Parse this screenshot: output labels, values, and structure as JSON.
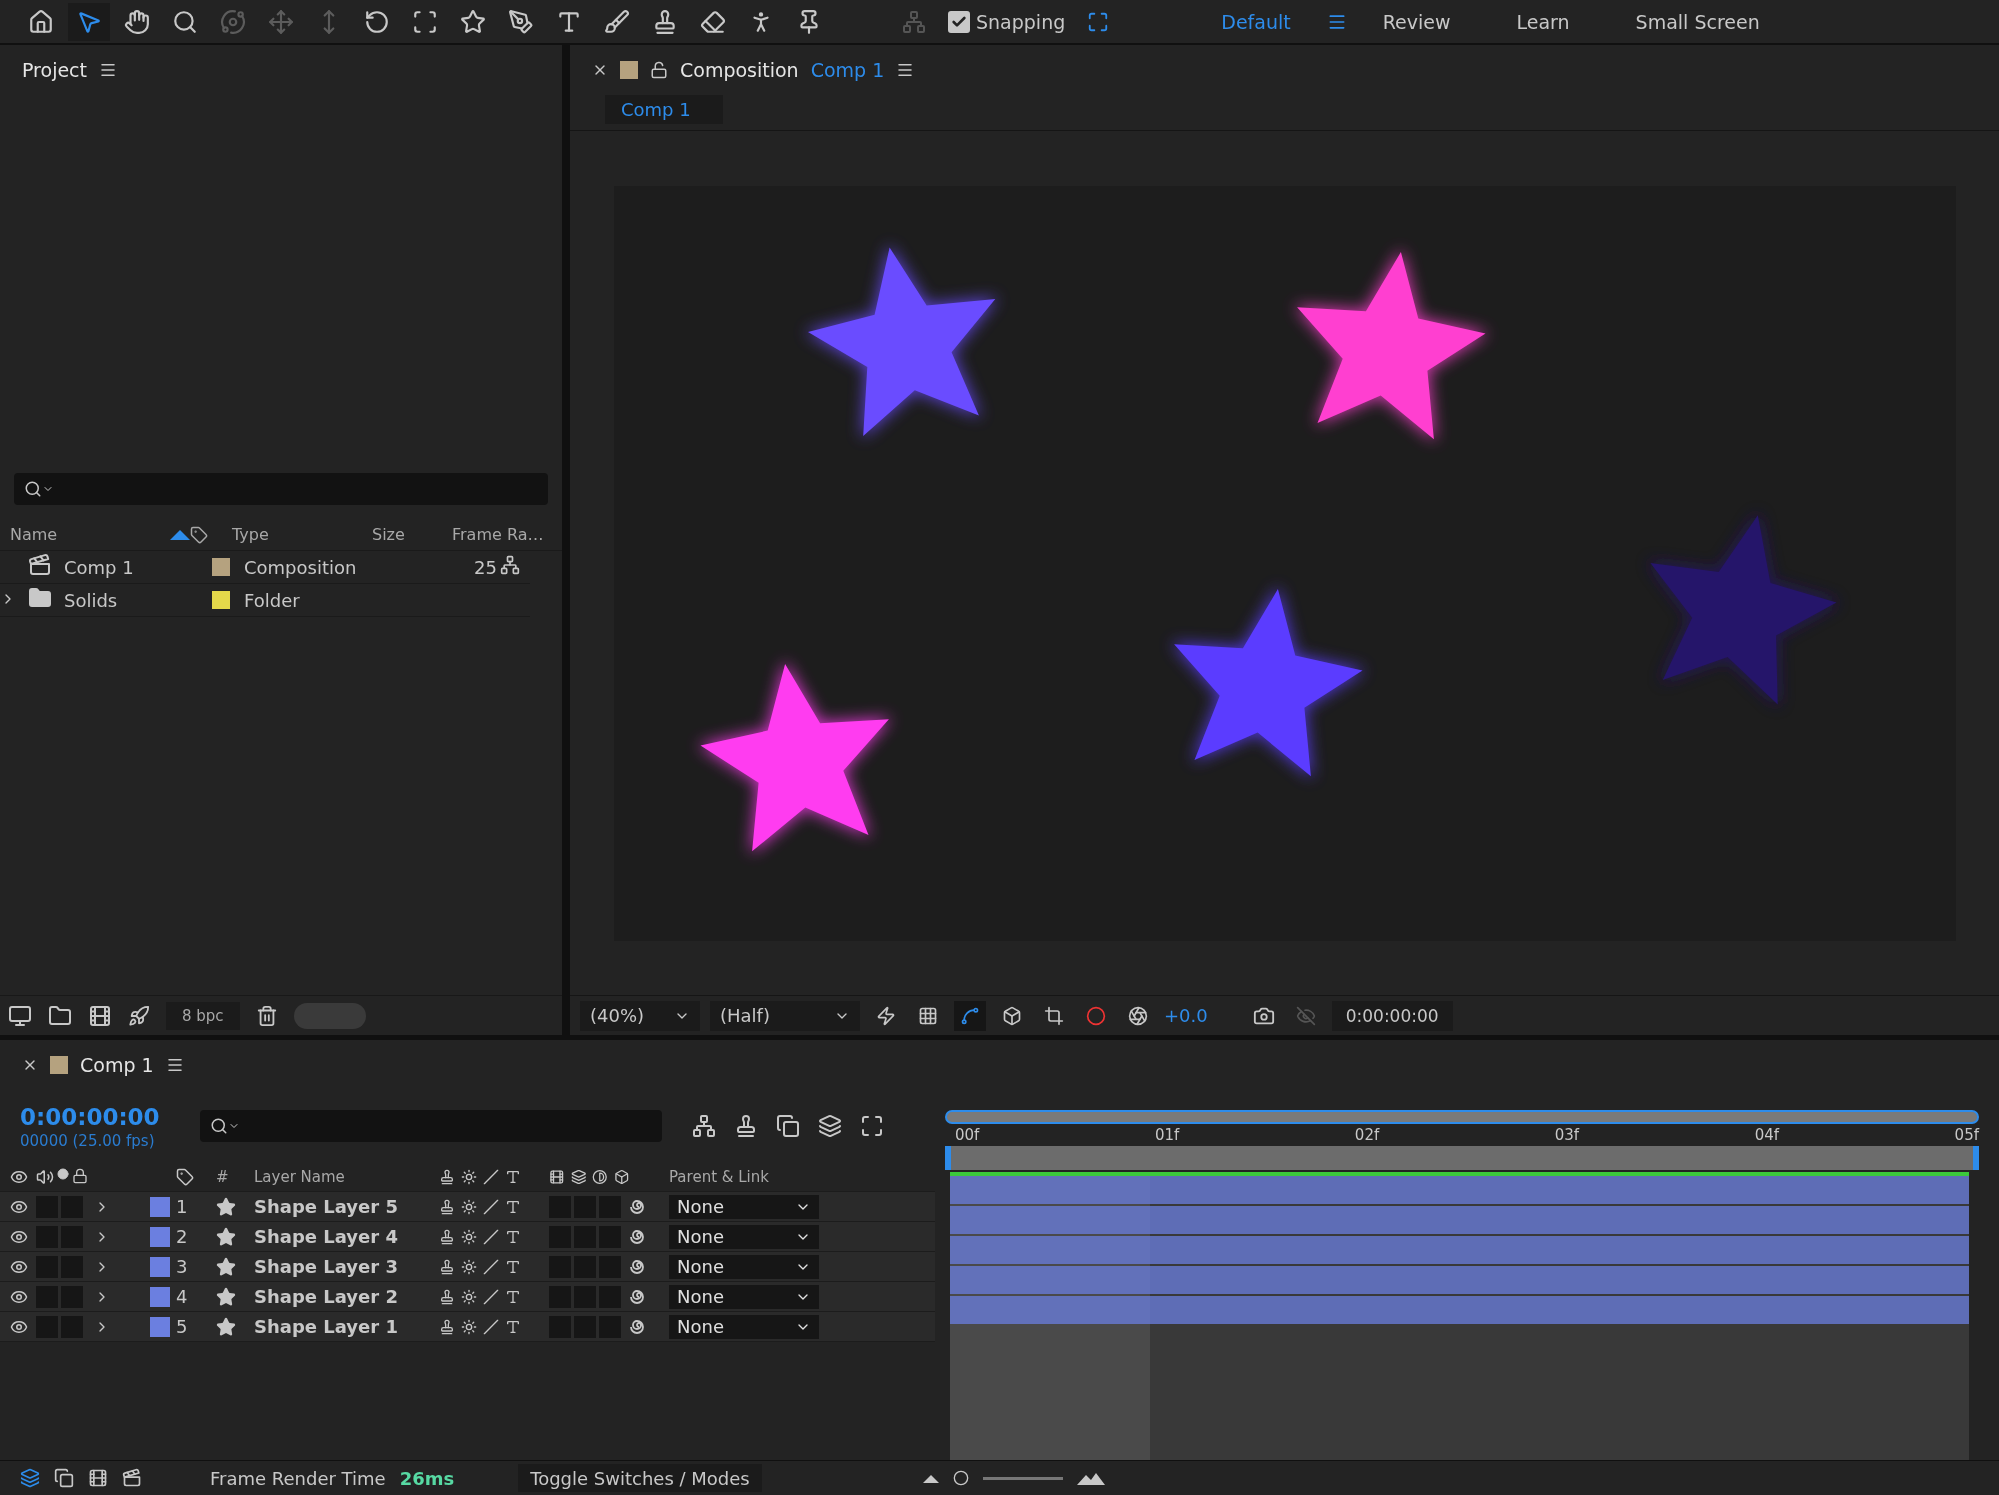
{
  "toolbar": {
    "tools": [
      {
        "kind": "home",
        "selected": false,
        "disabled": false
      },
      {
        "kind": "selection",
        "selected": true,
        "disabled": false
      },
      {
        "kind": "hand",
        "selected": false,
        "disabled": false
      },
      {
        "kind": "zoom",
        "selected": false,
        "disabled": false
      },
      {
        "kind": "orbit",
        "selected": false,
        "disabled": true
      },
      {
        "kind": "pan",
        "selected": false,
        "disabled": true
      },
      {
        "kind": "dolly",
        "selected": false,
        "disabled": true
      },
      {
        "kind": "rotate",
        "selected": false,
        "disabled": false
      },
      {
        "kind": "anchor",
        "selected": false,
        "disabled": false
      },
      {
        "kind": "star",
        "selected": false,
        "disabled": false
      },
      {
        "kind": "pen",
        "selected": false,
        "disabled": false
      },
      {
        "kind": "type",
        "selected": false,
        "disabled": false
      },
      {
        "kind": "brush",
        "selected": false,
        "disabled": false
      },
      {
        "kind": "stamp",
        "selected": false,
        "disabled": false
      },
      {
        "kind": "eraser",
        "selected": false,
        "disabled": false
      },
      {
        "kind": "puppet",
        "selected": false,
        "disabled": false
      },
      {
        "kind": "pin",
        "selected": false,
        "disabled": false
      }
    ],
    "snapping": {
      "label": "Snapping",
      "checked": true
    },
    "workspaces": [
      {
        "label": "Default",
        "selected": true
      },
      {
        "label": "Review",
        "selected": false
      },
      {
        "label": "Learn",
        "selected": false
      },
      {
        "label": "Small Screen",
        "selected": false
      }
    ]
  },
  "project": {
    "title": "Project",
    "columns": [
      "Name",
      "Type",
      "Size",
      "Frame Ra…"
    ],
    "items": [
      {
        "kind": "composition",
        "name": "Comp 1",
        "color": "#b5a27f",
        "type": "Composition",
        "frame_rate": "25"
      },
      {
        "kind": "folder",
        "name": "Solids",
        "color": "#e4d84a",
        "type": "Folder"
      }
    ],
    "bit_depth": "8 bpc"
  },
  "composition": {
    "title": "Composition",
    "comp_name": "Comp 1",
    "color": "#b5a27f",
    "tab": "Comp 1",
    "zoom": "(40%)",
    "resolution": "(Half)",
    "exposure": "+0.0",
    "timecode": "0:00:00:00"
  },
  "timeline": {
    "tab": "Comp 1",
    "color": "#b5a27f",
    "timecode": "0:00:00:00",
    "frame_info": "00000 (25.00 fps)",
    "columns": {
      "number": "#",
      "name": "Layer Name",
      "parent": "Parent & Link"
    },
    "ruler": [
      "00f",
      "01f",
      "02f",
      "03f",
      "04f",
      "05f"
    ],
    "layers": [
      {
        "number": "1",
        "name": "Shape Layer 5",
        "color": "#6b7fe0",
        "visible": true,
        "parent": "None"
      },
      {
        "number": "2",
        "name": "Shape Layer 4",
        "color": "#6b7fe0",
        "visible": true,
        "parent": "None"
      },
      {
        "number": "3",
        "name": "Shape Layer 3",
        "color": "#6b7fe0",
        "visible": true,
        "parent": "None"
      },
      {
        "number": "4",
        "name": "Shape Layer 2",
        "color": "#6b7fe0",
        "visible": true,
        "parent": "None"
      },
      {
        "number": "5",
        "name": "Shape Layer 1",
        "color": "#6b7fe0",
        "visible": true,
        "parent": "None"
      }
    ]
  },
  "status_bar": {
    "render_label": "Frame Render Time",
    "render_time": "26ms",
    "toggle": "Toggle Switches / Modes"
  }
}
